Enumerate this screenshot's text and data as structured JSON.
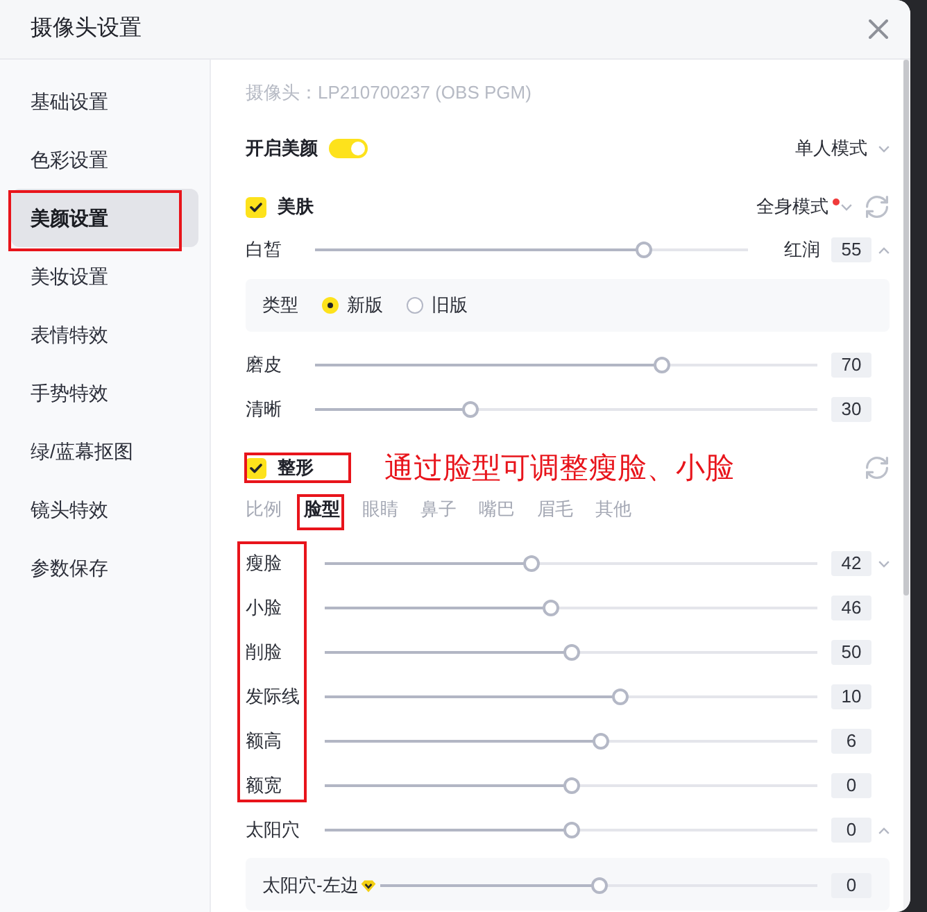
{
  "window": {
    "title": "摄像头设置"
  },
  "sidebar": {
    "items": [
      {
        "label": "基础设置",
        "selected": false,
        "highlighted": false
      },
      {
        "label": "色彩设置",
        "selected": false,
        "highlighted": false
      },
      {
        "label": "美颜设置",
        "selected": true,
        "highlighted": true
      },
      {
        "label": "美妆设置",
        "selected": false,
        "highlighted": false
      },
      {
        "label": "表情特效",
        "selected": false,
        "highlighted": false
      },
      {
        "label": "手势特效",
        "selected": false,
        "highlighted": false
      },
      {
        "label": "绿/蓝幕抠图",
        "selected": false,
        "highlighted": false
      },
      {
        "label": "镜头特效",
        "selected": false,
        "highlighted": false
      },
      {
        "label": "参数保存",
        "selected": false,
        "highlighted": false
      }
    ]
  },
  "camera": "摄像头：LP210700237 (OBS PGM)",
  "beauty": {
    "label": "开启美颜",
    "on": true,
    "mode": "单人模式"
  },
  "skin": {
    "label": "美肤",
    "checked": true,
    "mode": "全身模式",
    "notice_dot": true,
    "rows": [
      {
        "kind": "slider",
        "label": "白皙",
        "level": 0.76,
        "side_label": "红润",
        "reading": "55",
        "expanded": true
      },
      {
        "kind": "choice",
        "label": "类型",
        "options": [
          {
            "label": "新版",
            "selected": true
          },
          {
            "label": "旧版",
            "selected": false
          }
        ]
      },
      {
        "kind": "slider",
        "label": "磨皮",
        "level": 0.69,
        "reading": "70"
      },
      {
        "kind": "slider",
        "label": "清晰",
        "level": 0.31,
        "reading": "30"
      }
    ]
  },
  "shaping": {
    "label": "整形",
    "checked": true,
    "highlighted": true,
    "annotation": "通过脸型可调整瘦脸、小脸",
    "tabs": [
      {
        "label": "比例",
        "selected": false,
        "highlighted": false
      },
      {
        "label": "脸型",
        "selected": true,
        "highlighted": true
      },
      {
        "label": "眼睛",
        "selected": false,
        "highlighted": false
      },
      {
        "label": "鼻子",
        "selected": false,
        "highlighted": false
      },
      {
        "label": "嘴巴",
        "selected": false,
        "highlighted": false
      },
      {
        "label": "眉毛",
        "selected": false,
        "highlighted": false
      },
      {
        "label": "其他",
        "selected": false,
        "highlighted": false
      }
    ],
    "rows": [
      {
        "label": "瘦脸",
        "level": 0.42,
        "reading": "42",
        "expanded": false,
        "highlighted": true
      },
      {
        "label": "小脸",
        "level": 0.46,
        "reading": "46",
        "highlighted": true
      },
      {
        "label": "削脸",
        "level": 0.5,
        "reading": "50",
        "highlighted": true
      },
      {
        "label": "发际线",
        "level": 0.6,
        "reading": "10",
        "highlighted": true
      },
      {
        "label": "额高",
        "level": 0.56,
        "reading": "6",
        "highlighted": true
      },
      {
        "label": "额宽",
        "level": 0.5,
        "reading": "0",
        "highlighted": true
      },
      {
        "label": "太阳穴",
        "level": 0.5,
        "reading": "0",
        "expanded": true,
        "highlighted": false
      }
    ],
    "sub_rows": [
      {
        "label": "太阳穴-左边",
        "level": 0.5,
        "reading": "0",
        "vip": true
      }
    ]
  }
}
